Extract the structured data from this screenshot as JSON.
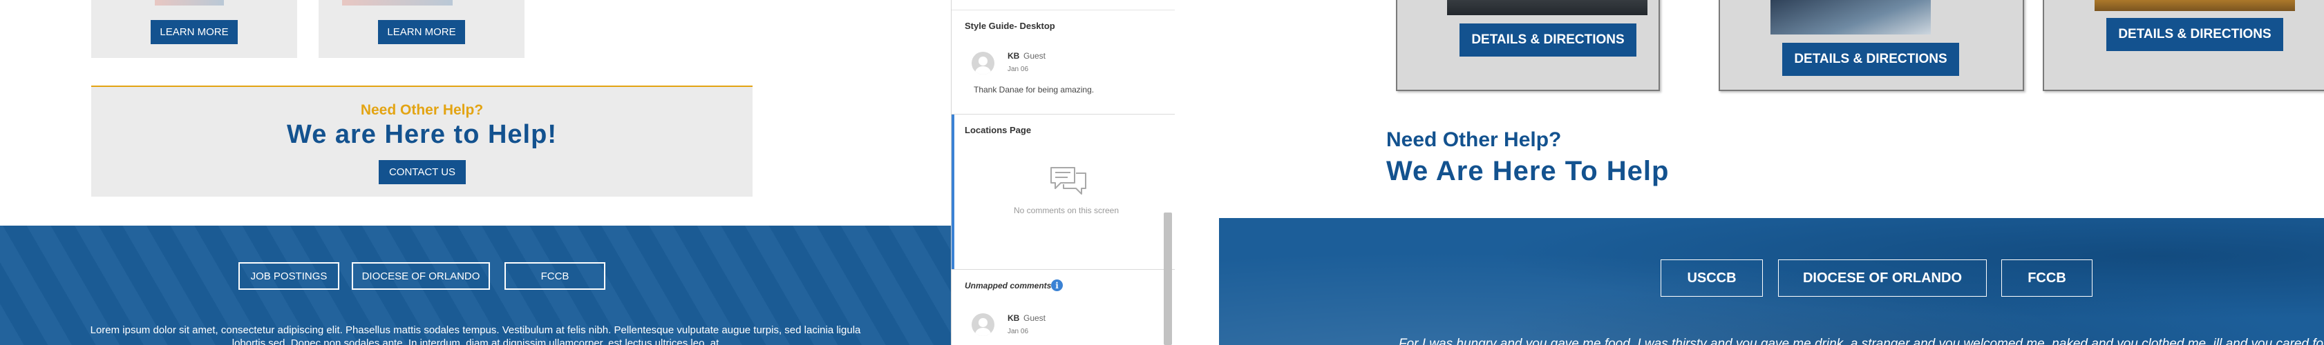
{
  "left_page": {
    "learn_more_1": "LEARN MORE",
    "learn_more_2": "LEARN MORE",
    "help_kicker": "Need Other Help?",
    "help_title": "We are Here to Help!",
    "contact_button": "CONTACT US",
    "footer_links": [
      "JOB POSTINGS",
      "DIOCESE OF ORLANDO",
      "FCCB"
    ],
    "footer_text_line1": "Lorem ipsum dolor sit amet, consectetur adipiscing elit. Phasellus mattis sodales tempus. Vestibulum at felis nibh. Pellentesque vulputate augue turpis, sed lacinia ligula",
    "footer_text_line2": "lobortis sed. Donec non sodales ante. In interdum, diam at dignissim ullamcorper, est lectus ultrices leo, at"
  },
  "comments_panel": {
    "section1_title": "Style Guide- Desktop",
    "comment1": {
      "author": "KB",
      "role": "Guest",
      "date": "Jan 06",
      "text": "Thank Danae for being amazing."
    },
    "section2_title": "Locations Page",
    "no_comments_text": "No comments on this screen",
    "unmapped_title": "Unmapped comments",
    "info_icon_glyph": "i",
    "comment2": {
      "author": "KB",
      "role": "Guest",
      "date": "Jan 06"
    }
  },
  "right_page": {
    "details_1": "DETAILS & DIRECTIONS",
    "details_2": "DETAILS & DIRECTIONS",
    "details_3": "DETAILS & DIRECTIONS",
    "help_kicker": "Need Other Help?",
    "help_title": "We Are Here To Help",
    "footer_links": [
      "USCCB",
      "DIOCESE OF ORLANDO",
      "FCCB"
    ],
    "footer_text_partial": "For I was hungry and you gave me food, I was thirsty and you gave me drink, a stranger and you welcomed me, naked and you clothed me, ill and you cared for me"
  },
  "colors": {
    "brand_blue": "#13528f",
    "gold": "#e3a413",
    "footer_blue": "#1c5e99",
    "panel_accent": "#3b82d4"
  }
}
